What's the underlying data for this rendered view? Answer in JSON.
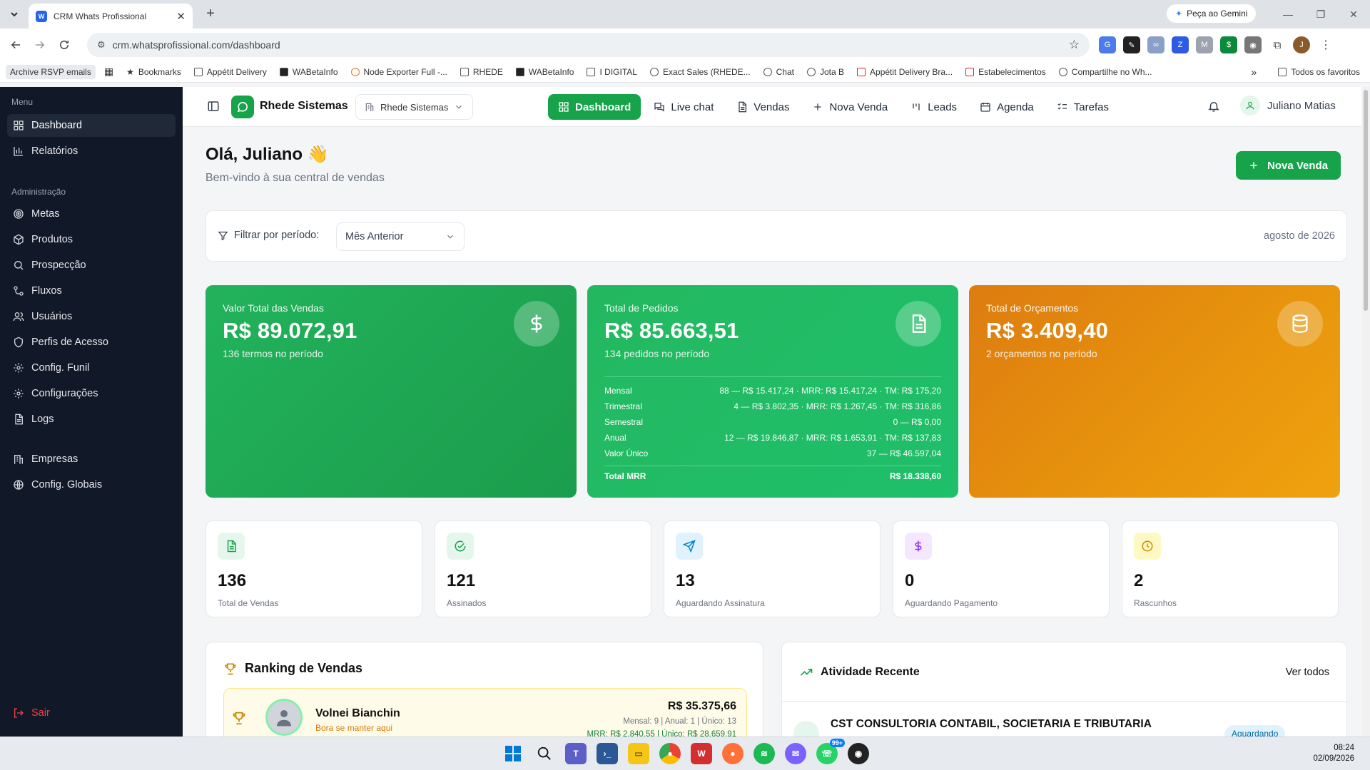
{
  "browser": {
    "tab_title": "CRM Whats Profissional",
    "url": "crm.whatsprofissional.com/dashboard",
    "gemini_label": "Peça ao Gemini",
    "bookmarks": [
      "Archive RSVP emails",
      "Bookmarks",
      "Appétit Delivery",
      "WABetaInfo",
      "Node Exporter Full -...",
      "RHEDE",
      "WABetaInfo",
      "I DIGITAL",
      "Exact Sales (RHEDE...",
      "Chat",
      "Jota B",
      "Appétit Delivery Bra...",
      "Estabelecimentos",
      "Compartilhe no Wh..."
    ],
    "bookmarks_all": "Todos os favoritos"
  },
  "sidebar": {
    "menu_title": "Menu",
    "menu_items": [
      {
        "label": "Dashboard",
        "icon": "grid-icon",
        "active": true
      },
      {
        "label": "Relatórios",
        "icon": "bar-chart-icon"
      }
    ],
    "admin_title": "Administração",
    "admin_items": [
      {
        "label": "Metas",
        "icon": "target-icon"
      },
      {
        "label": "Produtos",
        "icon": "package-icon"
      },
      {
        "label": "Prospecção",
        "icon": "search-icon"
      },
      {
        "label": "Fluxos",
        "icon": "workflow-icon"
      },
      {
        "label": "Usuários",
        "icon": "users-icon"
      },
      {
        "label": "Perfis de Acesso",
        "icon": "shield-icon"
      },
      {
        "label": "Config. Funil",
        "icon": "gear-icon"
      },
      {
        "label": "Configurações",
        "icon": "gear-icon"
      },
      {
        "label": "Logs",
        "icon": "file-icon"
      }
    ],
    "global_items": [
      {
        "label": "Empresas",
        "icon": "building-icon"
      },
      {
        "label": "Config. Globais",
        "icon": "globe-icon"
      }
    ],
    "logout": "Sair"
  },
  "header": {
    "brand": "Rhede Sistemas",
    "org_selector": "Rhede Sistemas",
    "nav": [
      {
        "label": "Dashboard",
        "active": true
      },
      {
        "label": "Live chat"
      },
      {
        "label": "Vendas"
      },
      {
        "label": "Nova Venda"
      },
      {
        "label": "Leads"
      },
      {
        "label": "Agenda"
      },
      {
        "label": "Tarefas"
      }
    ],
    "user_name": "Juliano Matias"
  },
  "main": {
    "greeting": "Olá, Juliano 👋",
    "subtitle": "Bem-vindo à sua central de vendas",
    "new_sale_button": "Nova Venda",
    "filter": {
      "label": "Filtrar por período:",
      "selected": "Mês Anterior",
      "period": "agosto de 2026"
    },
    "cards": [
      {
        "title": "Valor Total das Vendas",
        "value": "R$ 89.072,91",
        "sub": "136 termos no período",
        "icon": "dollar-icon",
        "color": "#1ea552"
      },
      {
        "title": "Total de Pedidos",
        "value": "R$ 85.663,51",
        "sub": "134 pedidos no período",
        "icon": "document-icon",
        "color": "#1fbf6b",
        "breakdown": [
          {
            "label": "Mensal",
            "value": "88 — R$ 15.417,24 · MRR: R$ 15.417,24 · TM: R$ 175,20"
          },
          {
            "label": "Trimestral",
            "value": "4 — R$ 3.802,35 · MRR: R$ 1.267,45 · TM: R$ 316,86"
          },
          {
            "label": "Semestral",
            "value": "0 — R$ 0,00"
          },
          {
            "label": "Anual",
            "value": "12 — R$ 19.846,87 · MRR: R$ 1.653,91 · TM: R$ 137,83"
          },
          {
            "label": "Valor Único",
            "value": "37 — R$ 46.597,04"
          }
        ],
        "total_label": "Total MRR",
        "total_value": "R$ 18.338,60"
      },
      {
        "title": "Total de Orçamentos",
        "value": "R$ 3.409,40",
        "sub": "2 orçamentos no período",
        "icon": "database-icon",
        "color": "#e8950d"
      }
    ],
    "stats": [
      {
        "value": "136",
        "label": "Total de Vendas",
        "icon": "file-text-icon",
        "bg": "#e5f6ec",
        "fg": "#16a34a"
      },
      {
        "value": "121",
        "label": "Assinados",
        "icon": "check-circle-icon",
        "bg": "#e5f6ec",
        "fg": "#16a34a"
      },
      {
        "value": "13",
        "label": "Aguardando Assinatura",
        "icon": "send-icon",
        "bg": "#e0f2fe",
        "fg": "#0284c7"
      },
      {
        "value": "0",
        "label": "Aguardando Pagamento",
        "icon": "dollar-icon",
        "bg": "#f3e8ff",
        "fg": "#9333ea"
      },
      {
        "value": "2",
        "label": "Rascunhos",
        "icon": "clock-icon",
        "bg": "#fef9c3",
        "fg": "#ca8a04"
      }
    ],
    "ranking": {
      "title": "Ranking de Vendas",
      "top": {
        "name": "Volnei Bianchin",
        "motto": "Bora se manter aqui",
        "amount": "R$ 35.375,66",
        "detail": "Mensal: 9 | Anual: 1 | Único: 13",
        "mrr": "MRR: R$ 2.840,55 | Único: R$ 28.659,91"
      }
    },
    "activity": {
      "title": "Atividade Recente",
      "view_all": "Ver todos",
      "first_company": "CST CONSULTORIA CONTABIL, SOCIETARIA E TRIBUTARIA",
      "first_status": "Aguardando"
    }
  },
  "taskbar": {
    "time": "08:24",
    "date": "02/09/2026",
    "badge": "99+"
  }
}
